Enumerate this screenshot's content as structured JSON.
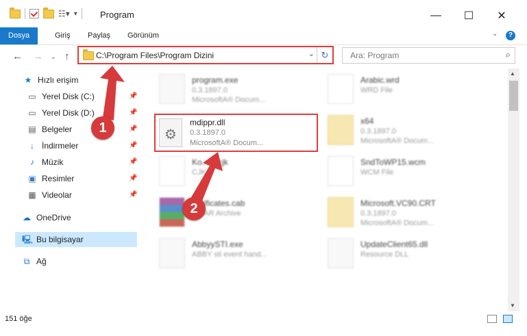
{
  "window": {
    "title": "Program"
  },
  "ribbon": {
    "tabs": [
      "Dosya",
      "Giriş",
      "Paylaş",
      "Görünüm"
    ]
  },
  "address": {
    "path": "C:\\Program Files\\Program Dizini"
  },
  "search": {
    "placeholder": "Ara: Program"
  },
  "sidebar": {
    "items": [
      {
        "label": "Hızlı erişim",
        "icon": "star-icon"
      },
      {
        "label": "Yerel Disk (C:)",
        "icon": "drive-icon"
      },
      {
        "label": "Yerel Disk (D:)",
        "icon": "drive-icon"
      },
      {
        "label": "Belgeler",
        "icon": "documents-icon"
      },
      {
        "label": "İndirmeler",
        "icon": "download-icon"
      },
      {
        "label": "Müzik",
        "icon": "music-icon"
      },
      {
        "label": "Resimler",
        "icon": "pictures-icon"
      },
      {
        "label": "Videolar",
        "icon": "videos-icon"
      },
      {
        "label": "OneDrive",
        "icon": "cloud-icon"
      },
      {
        "label": "Bu bilgisayar",
        "icon": "computer-icon"
      },
      {
        "label": "Ağ",
        "icon": "network-icon"
      }
    ]
  },
  "files": [
    {
      "name": "program.exe",
      "line1": "0.3.1897.0",
      "line2": "MicrosoftA® Docum..."
    },
    {
      "name": "Arabic.wrd",
      "line1": "WRD File",
      "line2": ""
    },
    {
      "name": "mdippr.dll",
      "line1": "0.3.1897.0",
      "line2": "MicrosoftA® Docum..."
    },
    {
      "name": "x64",
      "line1": "0.3.1897.0",
      "line2": "MicrosoftA® Docum..."
    },
    {
      "name": "Ko...m.cjk",
      "line1": "CJK...",
      "line2": ""
    },
    {
      "name": "SndToWP15.wcm",
      "line1": "WCM File",
      "line2": ""
    },
    {
      "name": "...rtificates.cab",
      "line1": "...RAR Archive",
      "line2": ""
    },
    {
      "name": "Microsoft.VC90.CRT",
      "line1": "0.3.1897.0",
      "line2": "MicrosoftA® Docum..."
    },
    {
      "name": "AbbyySTI.exe",
      "line1": "ABBY sti event hand...",
      "line2": ""
    },
    {
      "name": "UpdateClient65.dll",
      "line1": "Resource DLL",
      "line2": ""
    }
  ],
  "annotations": {
    "step1": "1",
    "step2": "2"
  },
  "status": {
    "count": "151 öğe"
  },
  "colors": {
    "accent": "#1979ca",
    "highlight": "#e03c3c",
    "selection": "#cce8ff"
  }
}
